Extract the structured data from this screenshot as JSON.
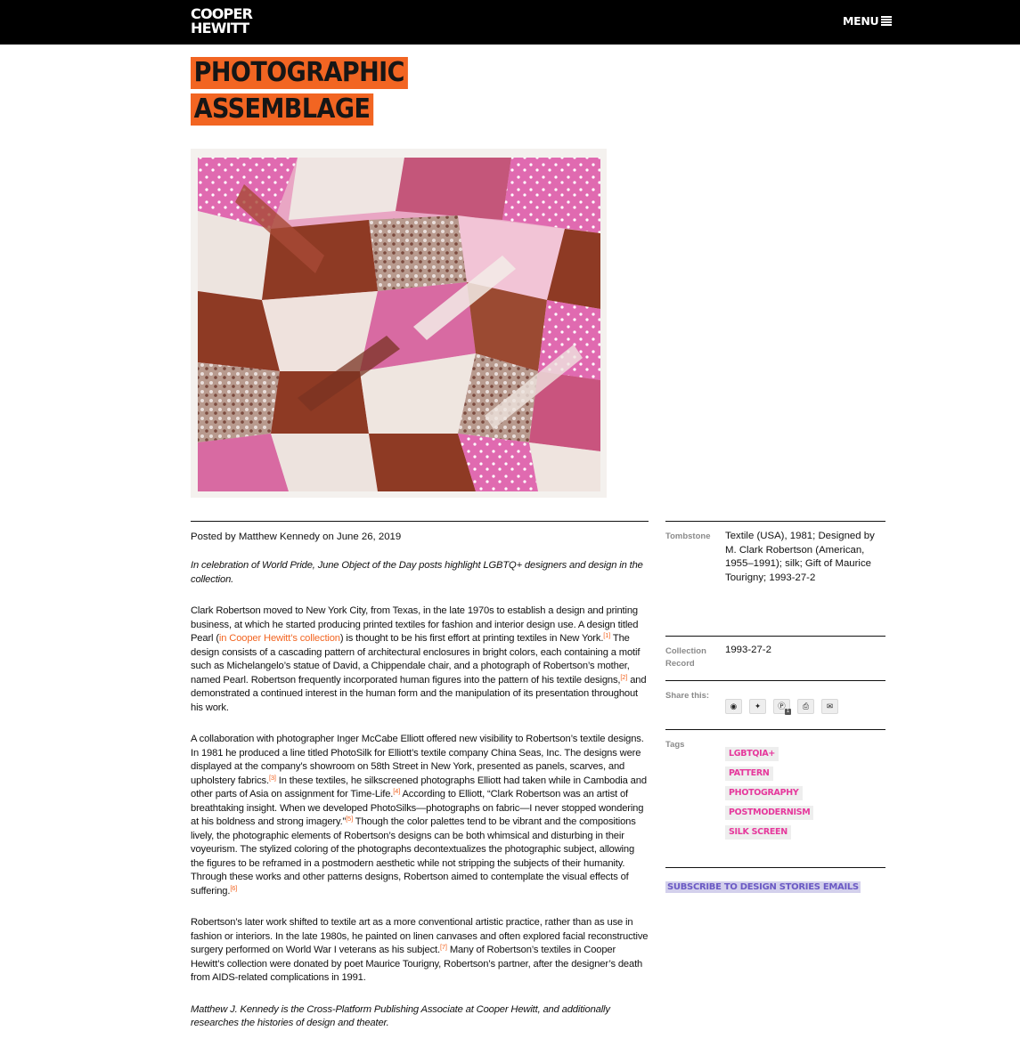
{
  "header": {
    "logo_line1": "COOPER",
    "logo_line2": "HEWITT",
    "menu_label": "MENU"
  },
  "article": {
    "title_line1": "PHOTOGRAPHIC",
    "title_line2": "ASSEMBLAGE",
    "posted": "Posted by Matthew Kennedy on June 26, 2019",
    "intro": "In celebration of World Pride, June Object of the Day posts highlight LGBTQ+ designers and design in the collection.",
    "p1_a": "Clark Robertson moved to New York City, from Texas, in the late 1970s to establish a design and printing business, at which he started producing printed textiles for fashion and interior design use. A design titled Pearl (",
    "p1_link": "in Cooper Hewitt’s collection",
    "p1_b": ") is thought to be his first effort at printing textiles in New York.",
    "fn1": "[1]",
    "p1_c": " The design consists of a cascading pattern of architectural enclosures in bright colors, each containing a motif such as Michelangelo’s statue of David, a Chippendale chair, and a photograph of Robertson’s mother, named Pearl. Robertson frequently incorporated human figures into the pattern of his textile designs,",
    "fn2": "[2]",
    "p1_d": " and demonstrated a continued interest in the human form and the manipulation of its presentation throughout his work.",
    "p2_a": "A collaboration with photographer Inger McCabe Elliott offered new visibility to Robertson’s textile designs. In 1981 he produced a line titled PhotoSilk for Elliott’s textile company China Seas, Inc. The designs were displayed at the company’s showroom on 58th Street in New York, presented as panels, scarves, and upholstery fabrics.",
    "fn3": "[3]",
    "p2_b": " In these textiles, he silkscreened photographs Elliott had taken while in Cambodia and other parts of Asia on assignment for Time-Life.",
    "fn4": "[4]",
    "p2_c": " According to Elliott, “Clark Robertson was an artist of breathtaking insight. When we developed PhotoSilks—photographs on fabric—I never stopped wondering at his boldness and strong imagery.”",
    "fn5": "[5]",
    "p2_d": " Though the color palettes tend to be vibrant and the compositions lively, the photographic elements of Robertson’s designs can be both whimsical and disturbing in their voyeurism. The stylized coloring of the photographs decontextualizes the photographic subject, allowing the figures to be reframed in a postmodern aesthetic while not stripping the subjects of their humanity. Through these works and other patterns designs, Robertson aimed to contemplate the visual effects of suffering.",
    "fn6": "[6]",
    "p3_a": "Robertson’s later work shifted to textile art as a more conventional artistic practice, rather than as use in fashion or interiors. In the late 1980s, he painted on linen canvases and often explored facial reconstructive surgery performed on World War I veterans as his subject.",
    "fn7": "[7]",
    "p3_b": " Many of Robertson’s textiles in Cooper Hewitt’s collection were donated by poet Maurice Tourigny, Robertson’s partner, after the designer’s death from AIDS-related complications in 1991.",
    "bio": "Matthew J. Kennedy is the Cross-Platform Publishing Associate at Cooper Hewitt, and additionally researches the histories of design and theater."
  },
  "sidebar": {
    "tombstone_label": "Tombstone",
    "tombstone_value": "Textile (USA), 1981; Designed by M. Clark Robertson (American, 1955–1991); silk; Gift of Maurice Tourigny; 1993-27-2",
    "collection_label": "Collection Record",
    "collection_value": "1993-27-2",
    "share_label": "Share this:",
    "pinterest_count": "1",
    "tags_label": "Tags",
    "tags": [
      "LGBTQIA+",
      "PATTERN",
      "PHOTOGRAPHY",
      "POSTMODERNISM",
      "SILK SCREEN"
    ],
    "subscribe": "SUBSCRIBE TO DESIGN STORIES EMAILS"
  },
  "icons": {
    "menu": "hamburger-icon",
    "share": [
      "facebook-icon",
      "twitter-icon",
      "pinterest-icon",
      "print-icon",
      "email-icon"
    ]
  },
  "colors": {
    "accent": "#f26522",
    "tag_text": "#e6389c",
    "subscribe_bg": "#d3d0ec",
    "subscribe_text": "#6b5ac4"
  }
}
